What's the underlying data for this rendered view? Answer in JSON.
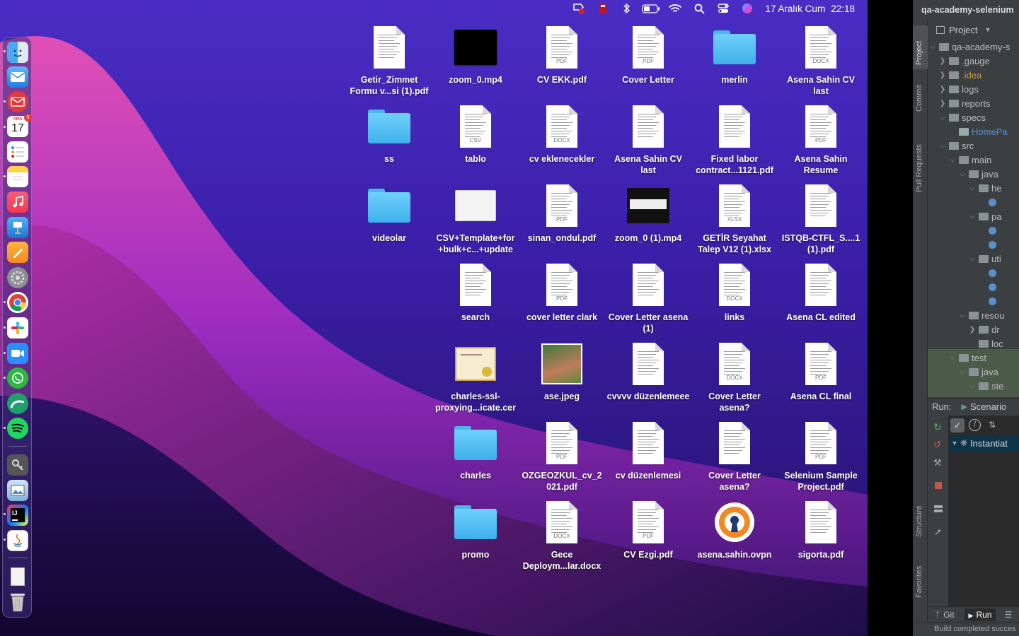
{
  "menubar": {
    "date": "17 Aralık Cum",
    "time": "22:18",
    "status_icons": [
      "antivirus-badge-icon",
      "red-app-icon",
      "bluetooth-icon",
      "battery-icon",
      "wifi-icon",
      "spotlight-search-icon",
      "control-center-icon",
      "siri-icon"
    ]
  },
  "dock": {
    "calendar_month": "ARA",
    "calendar_day": "17",
    "calendar_badge": "3",
    "apps": [
      "finder",
      "mail",
      "spark-mail",
      "calendar",
      "reminders",
      "notes",
      "music",
      "keynote",
      "pages",
      "system-preferences",
      "chrome",
      "slack",
      "zoom",
      "whatsapp",
      "tableplus",
      "spotify",
      "keychain-access",
      "preview",
      "intellij-idea",
      "java",
      "documents-stack",
      "trash"
    ]
  },
  "desktop_items": [
    {
      "label": "Getir_Zimmet Formu v...si (1).pdf",
      "kind": "doc",
      "tag": ""
    },
    {
      "label": "zoom_0.mp4",
      "kind": "video",
      "tag": ""
    },
    {
      "label": "CV EKK.pdf",
      "kind": "doc",
      "tag": "PDF"
    },
    {
      "label": "Cover Letter",
      "kind": "doc",
      "tag": "PDF"
    },
    {
      "label": "merlin",
      "kind": "folder",
      "tag": ""
    },
    {
      "label": "Asena Sahin CV last",
      "kind": "doc",
      "tag": "DOCX"
    },
    {
      "label": "ss",
      "kind": "folder",
      "tag": ""
    },
    {
      "label": "tablo",
      "kind": "doc",
      "tag": "CSV"
    },
    {
      "label": "cv eklenecekler",
      "kind": "doc",
      "tag": "DOCX"
    },
    {
      "label": "Asena Sahin CV last",
      "kind": "doc",
      "tag": ""
    },
    {
      "label": "Fixed labor contract...1121.pdf",
      "kind": "doc",
      "tag": ""
    },
    {
      "label": "Asena Sahin Resume",
      "kind": "doc",
      "tag": "PDF"
    },
    {
      "label": "videolar",
      "kind": "folder",
      "tag": ""
    },
    {
      "label": "CSV+Template+for +bulk+c...+update",
      "kind": "blank",
      "tag": ""
    },
    {
      "label": "sinan_ondul.pdf",
      "kind": "doc",
      "tag": "PDF"
    },
    {
      "label": "zoom_0 (1).mp4",
      "kind": "videoframe",
      "tag": ""
    },
    {
      "label": "GETİR Seyahat Talep V12 (1).xlsx",
      "kind": "doc",
      "tag": "XLSX"
    },
    {
      "label": "ISTQB-CTFL_S....1 (1).pdf",
      "kind": "doc",
      "tag": ""
    },
    {
      "label": "search",
      "kind": "doc",
      "tag": ""
    },
    {
      "label": "cover letter clark",
      "kind": "doc",
      "tag": "PDF"
    },
    {
      "label": "Cover Letter asena (1)",
      "kind": "doc",
      "tag": ""
    },
    {
      "label": "links",
      "kind": "doc",
      "tag": "DOCX"
    },
    {
      "label": "Asena CL edited",
      "kind": "doc",
      "tag": ""
    },
    {
      "label": "charles-ssl-proxying...icate.cer",
      "kind": "cert",
      "tag": ""
    },
    {
      "label": "ase.jpeg",
      "kind": "photo",
      "tag": ""
    },
    {
      "label": "cvvvv düzenlemeee",
      "kind": "doc",
      "tag": ""
    },
    {
      "label": "Cover Letter asena?",
      "kind": "doc",
      "tag": "DOCX"
    },
    {
      "label": "Asena CL final",
      "kind": "doc",
      "tag": "PDF"
    },
    {
      "label": "charles",
      "kind": "folder",
      "tag": ""
    },
    {
      "label": "OZGEOZKUL_cv_2 021.pdf",
      "kind": "doc",
      "tag": "PDF"
    },
    {
      "label": "cv düzenlemesi",
      "kind": "doc",
      "tag": ""
    },
    {
      "label": "Cover Letter asena?",
      "kind": "doc",
      "tag": ""
    },
    {
      "label": "Selenium Sample Project.pdf",
      "kind": "doc",
      "tag": "PDF"
    },
    {
      "label": "promo",
      "kind": "folder",
      "tag": ""
    },
    {
      "label": "Gece Deploym...lar.docx",
      "kind": "doc",
      "tag": "DOCX"
    },
    {
      "label": "CV Ezgi.pdf",
      "kind": "doc",
      "tag": "PDF"
    },
    {
      "label": "asena.sahin.ovpn",
      "kind": "vpn",
      "tag": ""
    },
    {
      "label": "sigorta.pdf",
      "kind": "doc",
      "tag": ""
    }
  ],
  "ide": {
    "title": "qa-academy-selenium",
    "vertical_tabs": [
      "Project",
      "Commit",
      "Pull Requests",
      "Structure",
      "Favorites"
    ],
    "project_dropdown": "Project",
    "tree": [
      {
        "label": "qa-academy-s",
        "arrow": "v",
        "color": "#bbbbbb"
      },
      {
        "label": ".gauge",
        "arrow": ">",
        "color": "#bbbbbb"
      },
      {
        "label": ".idea",
        "arrow": ">",
        "color": "#c8a03a"
      },
      {
        "label": "logs",
        "arrow": ">",
        "color": "#bbbbbb"
      },
      {
        "label": "reports",
        "arrow": ">",
        "color": "#bbbbbb"
      },
      {
        "label": "specs",
        "arrow": "v",
        "color": "#bbbbbb"
      },
      {
        "label": "HomePa",
        "arrow": "",
        "color": "#5b8fc9"
      },
      {
        "label": "src",
        "arrow": "v",
        "color": "#bbbbbb"
      },
      {
        "label": "main",
        "arrow": "v",
        "color": "#bbbbbb"
      },
      {
        "label": "java",
        "arrow": "v",
        "color": "#bbbbbb"
      },
      {
        "label": "he",
        "arrow": "v",
        "color": "#bbbbbb"
      },
      {
        "label": "",
        "arrow": "",
        "color": "#bbbbbb"
      },
      {
        "label": "pa",
        "arrow": "v",
        "color": "#bbbbbb"
      },
      {
        "label": "",
        "arrow": "",
        "color": "#bbbbbb"
      },
      {
        "label": "",
        "arrow": "",
        "color": "#bbbbbb"
      },
      {
        "label": "uti",
        "arrow": "v",
        "color": "#bbbbbb"
      },
      {
        "label": "",
        "arrow": "",
        "color": "#bbbbbb"
      },
      {
        "label": "",
        "arrow": "",
        "color": "#bbbbbb"
      },
      {
        "label": "",
        "arrow": "",
        "color": "#bbbbbb"
      },
      {
        "label": "resou",
        "arrow": "v",
        "color": "#bbbbbb"
      },
      {
        "label": "dr",
        "arrow": ">",
        "color": "#bbbbbb"
      },
      {
        "label": "loc",
        "arrow": "",
        "color": "#bbbbbb"
      },
      {
        "label": "test",
        "arrow": "v",
        "color": "#bbbbbb"
      },
      {
        "label": "java",
        "arrow": "v",
        "color": "#bbbbbb"
      },
      {
        "label": "ste",
        "arrow": "v",
        "color": "#bbbbbb"
      }
    ],
    "run_label": "Run:",
    "run_config": "Scenario",
    "run_tree_item": "Instantiat",
    "bottom_tabs": [
      "Git",
      "Run"
    ],
    "status": "Build completed succes"
  }
}
